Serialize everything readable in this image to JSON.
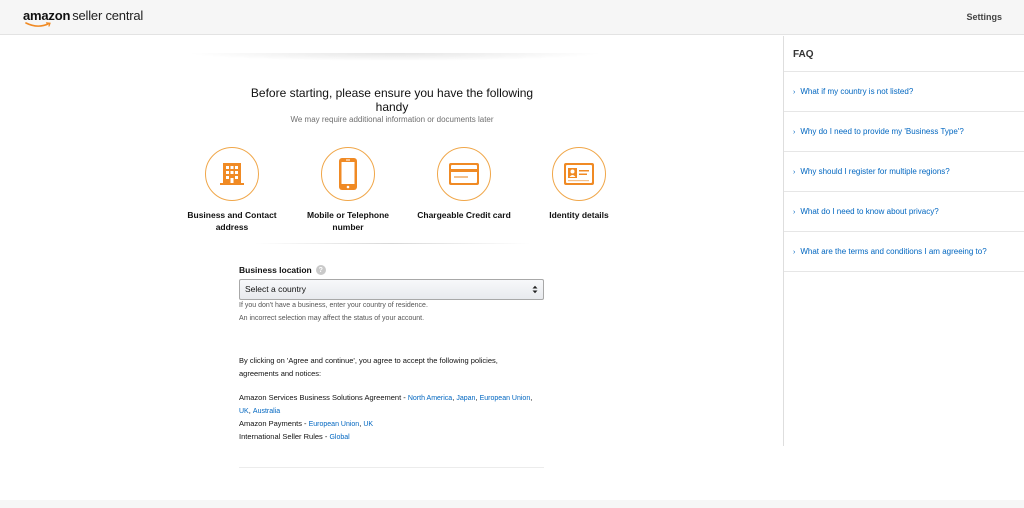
{
  "header": {
    "logo_brand": "amazon",
    "logo_product": "seller central",
    "settings_label": "Settings"
  },
  "main": {
    "headline": "Before starting, please ensure you have the following handy",
    "subline": "We may require additional information or documents later",
    "requirements": [
      {
        "label": "Business and Contact address",
        "icon": "building-icon"
      },
      {
        "label": "Mobile or Telephone number",
        "icon": "mobile-phone-icon"
      },
      {
        "label": "Chargeable Credit card",
        "icon": "credit-card-icon"
      },
      {
        "label": "Identity details",
        "icon": "id-card-icon"
      }
    ],
    "location": {
      "label": "Business location",
      "help": "?",
      "select_value": "Select a country",
      "hint1": "If you don't have a business, enter your country of residence.",
      "hint2": "An incorrect selection may affect the status of your account."
    },
    "agree_text": "By clicking on 'Agree and continue', you agree to accept the following policies, agreements and notices:",
    "policies": [
      {
        "name": "Amazon Services Business Solutions Agreement - ",
        "links": [
          "North America",
          "Japan",
          "European Union",
          "UK",
          "Australia"
        ]
      },
      {
        "name": "Amazon Payments - ",
        "links": [
          "European Union",
          "UK"
        ]
      },
      {
        "name": "International Seller Rules - ",
        "links": [
          "Global"
        ]
      }
    ]
  },
  "faq": {
    "title": "FAQ",
    "items": [
      "What if my country is not listed?",
      "Why do I need to provide my 'Business Type'?",
      "Why should I register for multiple regions?",
      "What do I need to know about privacy?",
      "What are the terms and conditions I am agreeing to?"
    ]
  },
  "colors": {
    "accent_orange": "#f0a74a",
    "icon_orange": "#f08a24",
    "link_blue": "#0066c0"
  }
}
